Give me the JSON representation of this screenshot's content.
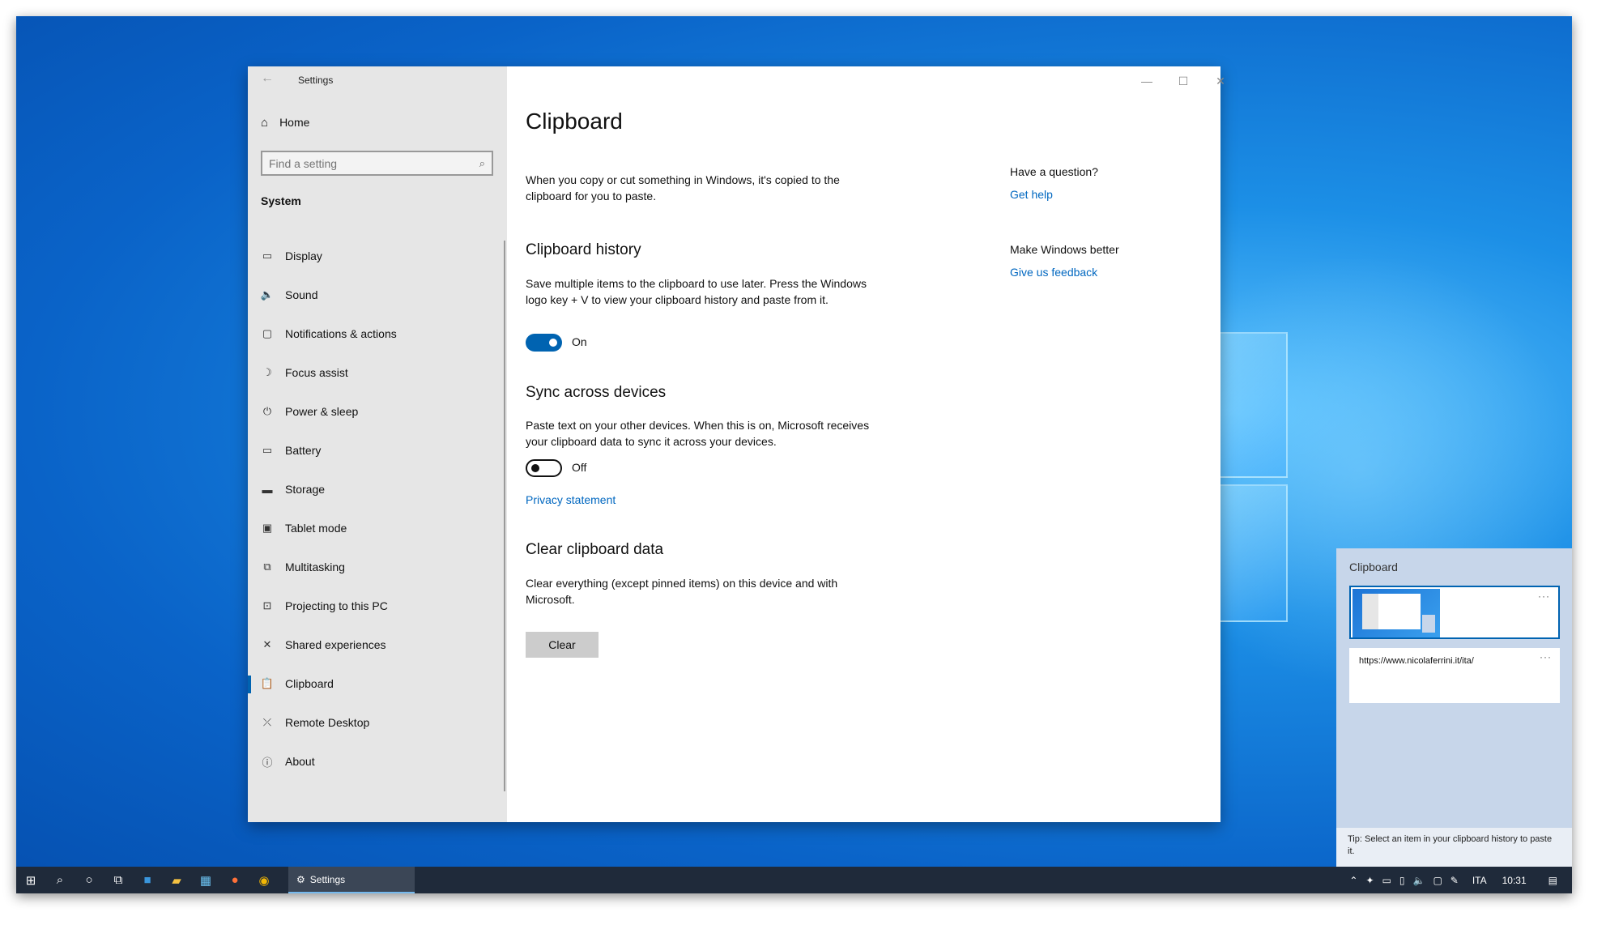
{
  "window": {
    "title": "Settings",
    "controls": {
      "minimize": "—",
      "maximize": "☐",
      "close": "✕"
    }
  },
  "sidebar": {
    "home_label": "Home",
    "search_placeholder": "Find a setting",
    "section": "System",
    "items": [
      {
        "label": "Display",
        "icon": "display-icon",
        "glyph": "▭"
      },
      {
        "label": "Sound",
        "icon": "sound-icon",
        "glyph": "🔈"
      },
      {
        "label": "Notifications & actions",
        "icon": "notifications-icon",
        "glyph": "▢"
      },
      {
        "label": "Focus assist",
        "icon": "focus-assist-icon",
        "glyph": "☽"
      },
      {
        "label": "Power & sleep",
        "icon": "power-icon",
        "glyph": "⏻"
      },
      {
        "label": "Battery",
        "icon": "battery-icon",
        "glyph": "▭"
      },
      {
        "label": "Storage",
        "icon": "storage-icon",
        "glyph": "▬"
      },
      {
        "label": "Tablet mode",
        "icon": "tablet-mode-icon",
        "glyph": "▣"
      },
      {
        "label": "Multitasking",
        "icon": "multitasking-icon",
        "glyph": "⧉"
      },
      {
        "label": "Projecting to this PC",
        "icon": "projecting-icon",
        "glyph": "⊡"
      },
      {
        "label": "Shared experiences",
        "icon": "shared-experiences-icon",
        "glyph": "✕"
      },
      {
        "label": "Clipboard",
        "icon": "clipboard-icon",
        "glyph": "📋"
      },
      {
        "label": "Remote Desktop",
        "icon": "remote-desktop-icon",
        "glyph": "⤫"
      },
      {
        "label": "About",
        "icon": "about-icon",
        "glyph": "ⓘ"
      }
    ],
    "active_item": "Clipboard"
  },
  "main": {
    "title": "Clipboard",
    "intro": "When you copy or cut something in Windows, it's copied to the clipboard for you to paste.",
    "history": {
      "heading": "Clipboard history",
      "description": "Save multiple items to the clipboard to use later. Press the Windows logo key + V to view your clipboard history and paste from it.",
      "toggle_state": "On"
    },
    "sync": {
      "heading": "Sync across devices",
      "description": "Paste text on your other devices. When this is on, Microsoft receives your clipboard data to sync it across your devices.",
      "toggle_state": "Off",
      "privacy_link": "Privacy statement"
    },
    "clear": {
      "heading": "Clear clipboard data",
      "description": "Clear everything (except pinned items) on this device and with Microsoft.",
      "button_label": "Clear"
    }
  },
  "help": {
    "question": "Have a question?",
    "get_help": "Get help",
    "better": "Make Windows better",
    "feedback": "Give us feedback"
  },
  "flyout": {
    "title": "Clipboard",
    "item_more": "···",
    "url_item": "https://www.nicolaferrini.it/ita/",
    "tip": "Tip: Select an item in your clipboard history to paste it."
  },
  "taskbar": {
    "active_app": "Settings",
    "language": "ITA",
    "time": "10:31"
  },
  "colors": {
    "accent": "#0063b1",
    "link": "#0067c0",
    "sidebar_bg": "#e6e6e6",
    "taskbar_bg": "#1f2a3a"
  }
}
